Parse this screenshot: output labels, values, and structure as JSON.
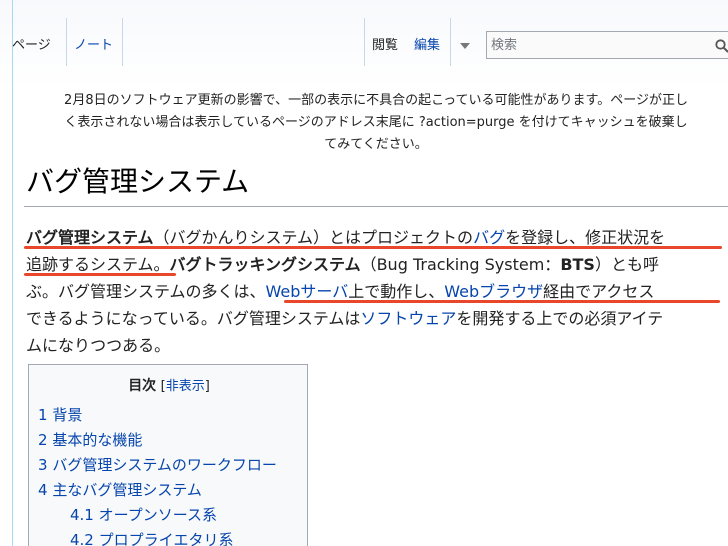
{
  "tabs": {
    "page": "ページ",
    "note": "ノート",
    "view": "閲覧",
    "edit": "編集"
  },
  "search": {
    "placeholder": "検索",
    "icon": "search-icon"
  },
  "notice": {
    "line1": "2月8日のソフトウェア更新の影響で、一部の表示に不具合の起こっている可能性があります。ページが正し",
    "line2": "く表示されない場合は表示しているページのアドレス末尾に ?action=purge を付けてキャッシュを破棄し",
    "line3": "てみてください。"
  },
  "article": {
    "title": "バグ管理システム",
    "p1": {
      "s1": "バグ管理システム",
      "s2": "（バグかんりシステム）とはプロジェクトの",
      "s3": "バグ",
      "s4": "を登録し、修正状況を"
    },
    "p2": {
      "s1": "追跡するシステム。",
      "s2": "バグトラッキングシステム",
      "s3": "（Bug Tracking System：",
      "s4": "BTS",
      "s5": "）とも呼"
    },
    "p3": {
      "s1": "ぶ。バグ管理システムの多くは、",
      "s2": "Webサーバ",
      "s3": "上で動作し、",
      "s4": "Webブラウザ",
      "s5": "経由でアクセス"
    },
    "p4": {
      "s1": "できるようになっている。バグ管理システムは",
      "s2": "ソフトウェア",
      "s3": "を開発する上での必須アイテ"
    },
    "p5": {
      "s1": "ムになりつつある。"
    },
    "highlight_color": "#e8472b"
  },
  "toc": {
    "title": "目次",
    "toggle_open": "[",
    "toggle": "非表示",
    "toggle_close": "]",
    "items": [
      {
        "num": "1",
        "label": "背景"
      },
      {
        "num": "2",
        "label": "基本的な機能"
      },
      {
        "num": "3",
        "label": "バグ管理システムのワークフロー"
      },
      {
        "num": "4",
        "label": "主なバグ管理システム"
      },
      {
        "num": "4.1",
        "label": "オープンソース系"
      },
      {
        "num": "4.2",
        "label": "プロプライエタリ系"
      }
    ]
  },
  "colors": {
    "link": "#0645ad",
    "border": "#a7d7f9"
  }
}
